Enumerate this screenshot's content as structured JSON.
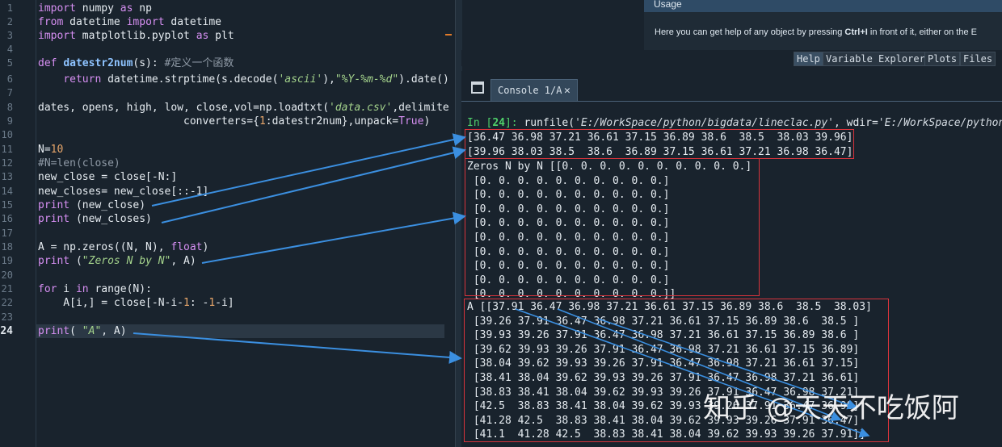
{
  "editor": {
    "line_numbers": [
      "1",
      "2",
      "3",
      "4",
      "5",
      "6",
      "7",
      "8",
      "9",
      "10",
      "11",
      "12",
      "13",
      "14",
      "15",
      "16",
      "17",
      "18",
      "19",
      "20",
      "21",
      "22",
      "23",
      "24"
    ],
    "lines": {
      "l1": [
        "import",
        " numpy ",
        "as",
        " np"
      ],
      "l2": [
        "from",
        " datetime ",
        "import",
        " datetime"
      ],
      "l3": [
        "import",
        " matplotlib.pyplot ",
        "as",
        " plt"
      ],
      "l5": [
        "def ",
        "datestr2num",
        "(s): ",
        "#定义一个函数"
      ],
      "l6": [
        "    ",
        "return",
        " datetime.strptime(s.decode(",
        "'ascii'",
        "),",
        "\"%Y-%m-%d\"",
        ").date()"
      ],
      "l8": [
        "dates, opens, high, low, close,vol=np.loadtxt(",
        "'data.csv'",
        ",delimite"
      ],
      "l9": [
        "                       converters={",
        "1",
        ":datestr2num},unpack=",
        "True",
        ")"
      ],
      "l11": [
        "N=",
        "10"
      ],
      "l12": [
        "#N=len(close)"
      ],
      "l13": [
        "new_close = close[-N:]"
      ],
      "l14": [
        "new_closes= new_close[::-1]"
      ],
      "l15": [
        "print",
        " (new_close)"
      ],
      "l16": [
        "print",
        " (new_closes)"
      ],
      "l18": [
        "A = np.zeros((N, N), ",
        "float",
        ")"
      ],
      "l19": [
        "print",
        " (",
        "\"Zeros N by N\"",
        ", A)"
      ],
      "l21": [
        "for",
        " i ",
        "in",
        " range(N):"
      ],
      "l22": [
        "    A[i,] = close[-N-i-",
        "1",
        ": -",
        "1",
        "-i]"
      ],
      "l24": [
        "print",
        "( ",
        "\"A\"",
        ", A)"
      ]
    }
  },
  "help_pane": {
    "title": "Usage",
    "text_before": "Here you can get help of any object by pressing ",
    "shortcut": "Ctrl+I",
    "text_after": " in front of it, either on the E"
  },
  "pane_tabs": [
    "Help",
    "Variable Explorer",
    "Plots",
    "Files"
  ],
  "console_tab": {
    "label": "Console 1/A",
    "close": "✕"
  },
  "console": {
    "prompt_prefix": "In [",
    "prompt_num": "24",
    "prompt_suffix": "]: ",
    "runfile_a": "runfile(",
    "runfile_path": "'E:/WorkSpace/python/bigdata/lineclac.py'",
    "runfile_b": ", wdir=",
    "runfile_wdir": "'E:/WorkSpace/python",
    "out_new_close": "[36.47 36.98 37.21 36.61 37.15 36.89 38.6  38.5  38.03 39.96]",
    "out_new_closes": "[39.96 38.03 38.5  38.6  36.89 37.15 36.61 37.21 36.98 36.47]",
    "zeros_lines": [
      "Zeros N by N [[0. 0. 0. 0. 0. 0. 0. 0. 0. 0.]",
      " [0. 0. 0. 0. 0. 0. 0. 0. 0. 0.]",
      " [0. 0. 0. 0. 0. 0. 0. 0. 0. 0.]",
      " [0. 0. 0. 0. 0. 0. 0. 0. 0. 0.]",
      " [0. 0. 0. 0. 0. 0. 0. 0. 0. 0.]",
      " [0. 0. 0. 0. 0. 0. 0. 0. 0. 0.]",
      " [0. 0. 0. 0. 0. 0. 0. 0. 0. 0.]",
      " [0. 0. 0. 0. 0. 0. 0. 0. 0. 0.]",
      " [0. 0. 0. 0. 0. 0. 0. 0. 0. 0.]",
      " [0. 0. 0. 0. 0. 0. 0. 0. 0. 0.]]"
    ],
    "a_lines": [
      "A [[37.91 36.47 36.98 37.21 36.61 37.15 36.89 38.6  38.5  38.03]",
      " [39.26 37.91 36.47 36.98 37.21 36.61 37.15 36.89 38.6  38.5 ]",
      " [39.93 39.26 37.91 36.47 36.98 37.21 36.61 37.15 36.89 38.6 ]",
      " [39.62 39.93 39.26 37.91 36.47 36.98 37.21 36.61 37.15 36.89]",
      " [38.04 39.62 39.93 39.26 37.91 36.47 36.98 37.21 36.61 37.15]",
      " [38.41 38.04 39.62 39.93 39.26 37.91 36.47 36.98 37.21 36.61]",
      " [38.83 38.41 38.04 39.62 39.93 39.26 37.91 36.47 36.98 37.21]",
      " [42.5  38.83 38.41 38.04 39.62 39.93 39.26 37.91 36.47 36.98]",
      " [41.28 42.5  38.83 38.41 38.04 39.62 39.93 39.26 37.91 36.47]",
      " [41.1  41.28 42.5  38.83 38.41 38.04 39.62 39.93 39.26 37.91]]"
    ]
  },
  "watermark": "知乎 @天天不吃饭阿",
  "colors": {
    "background": "#19232d",
    "annotation_arrow": "#3b8fe0",
    "highlight_box": "#d9343c"
  }
}
